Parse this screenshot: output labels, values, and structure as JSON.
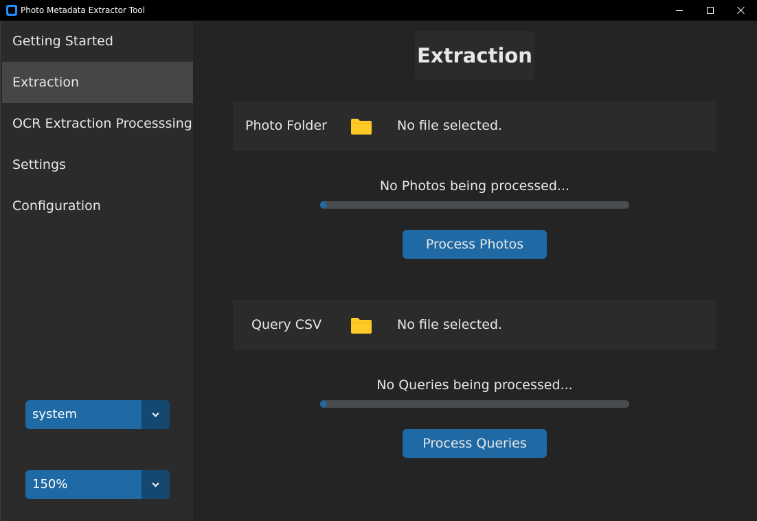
{
  "window": {
    "title": "Photo Metadata Extractor Tool"
  },
  "sidebar": {
    "items": [
      {
        "label": "Getting Started",
        "active": false
      },
      {
        "label": "Extraction",
        "active": true
      },
      {
        "label": "OCR Extraction Processsing",
        "active": false
      },
      {
        "label": "Settings",
        "active": false
      },
      {
        "label": "Configuration",
        "active": false
      }
    ],
    "appearance_mode": "system",
    "ui_scaling": "150%"
  },
  "main": {
    "title": "Extraction",
    "photo": {
      "label": "Photo Folder",
      "file": "No file selected.",
      "status": "No Photos being processed...",
      "progress": 0.02,
      "button": "Process Photos"
    },
    "query": {
      "label": "Query CSV",
      "file": "No file selected.",
      "status": "No Queries being processed...",
      "progress": 0.02,
      "button": "Process Queries"
    }
  },
  "colors": {
    "accent": "#1f6aa5",
    "folder": "#ffca28",
    "sidebar_bg": "#2b2b2b",
    "main_bg": "#242424"
  },
  "icons": {
    "app": "app-icon",
    "folder": "folder-icon",
    "dropdown": "chevron-down-icon"
  }
}
